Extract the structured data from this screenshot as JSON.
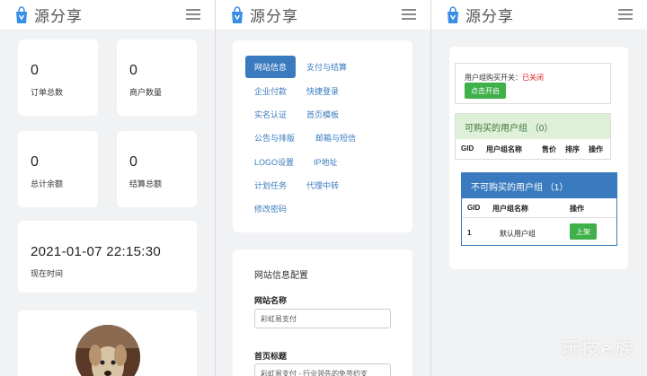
{
  "brand": "源分享",
  "colors": {
    "accent": "#3a7bbf",
    "green": "#3fb04a",
    "red": "#e02020"
  },
  "dashboard": {
    "stats": [
      {
        "value": "0",
        "label": "订单总数"
      },
      {
        "value": "0",
        "label": "商户数量"
      },
      {
        "value": "0",
        "label": "总计余额"
      },
      {
        "value": "0",
        "label": "结算总额"
      }
    ],
    "time": {
      "value": "2021-01-07 22:15:30",
      "label": "现在时间"
    }
  },
  "settings": {
    "tabs": [
      "网站信息",
      "支付与结算",
      "企业付款",
      "快捷登录",
      "实名认证",
      "首页模板",
      "公告与排版",
      "邮箱与短信",
      "LOGO设置",
      "IP地址",
      "计划任务",
      "代理中转",
      "修改密码"
    ],
    "config": {
      "title": "网站信息配置",
      "site_name_label": "网站名称",
      "site_name_value": "彩虹易支付",
      "home_title_label": "首页标题",
      "home_title_value": "彩虹易支付 - 行业领先的免签约支"
    }
  },
  "usergroups": {
    "purchase_toggle_label": "用户组购买开关：",
    "purchase_toggle_status": "已关闭",
    "enable_button": "点击开启",
    "buyable": {
      "title": "可购买的用户组",
      "count": "（0）",
      "headers": [
        "GID",
        "用户组名称",
        "售价",
        "排序",
        "操作"
      ]
    },
    "non_buyable": {
      "title": "不可购买的用户组",
      "count": "（1）",
      "headers": [
        "GID",
        "用户组名称",
        "操作"
      ],
      "rows": [
        {
          "gid": "1",
          "name": "默认用户组",
          "action": "上架"
        }
      ]
    }
  },
  "watermark": "玩技e族"
}
